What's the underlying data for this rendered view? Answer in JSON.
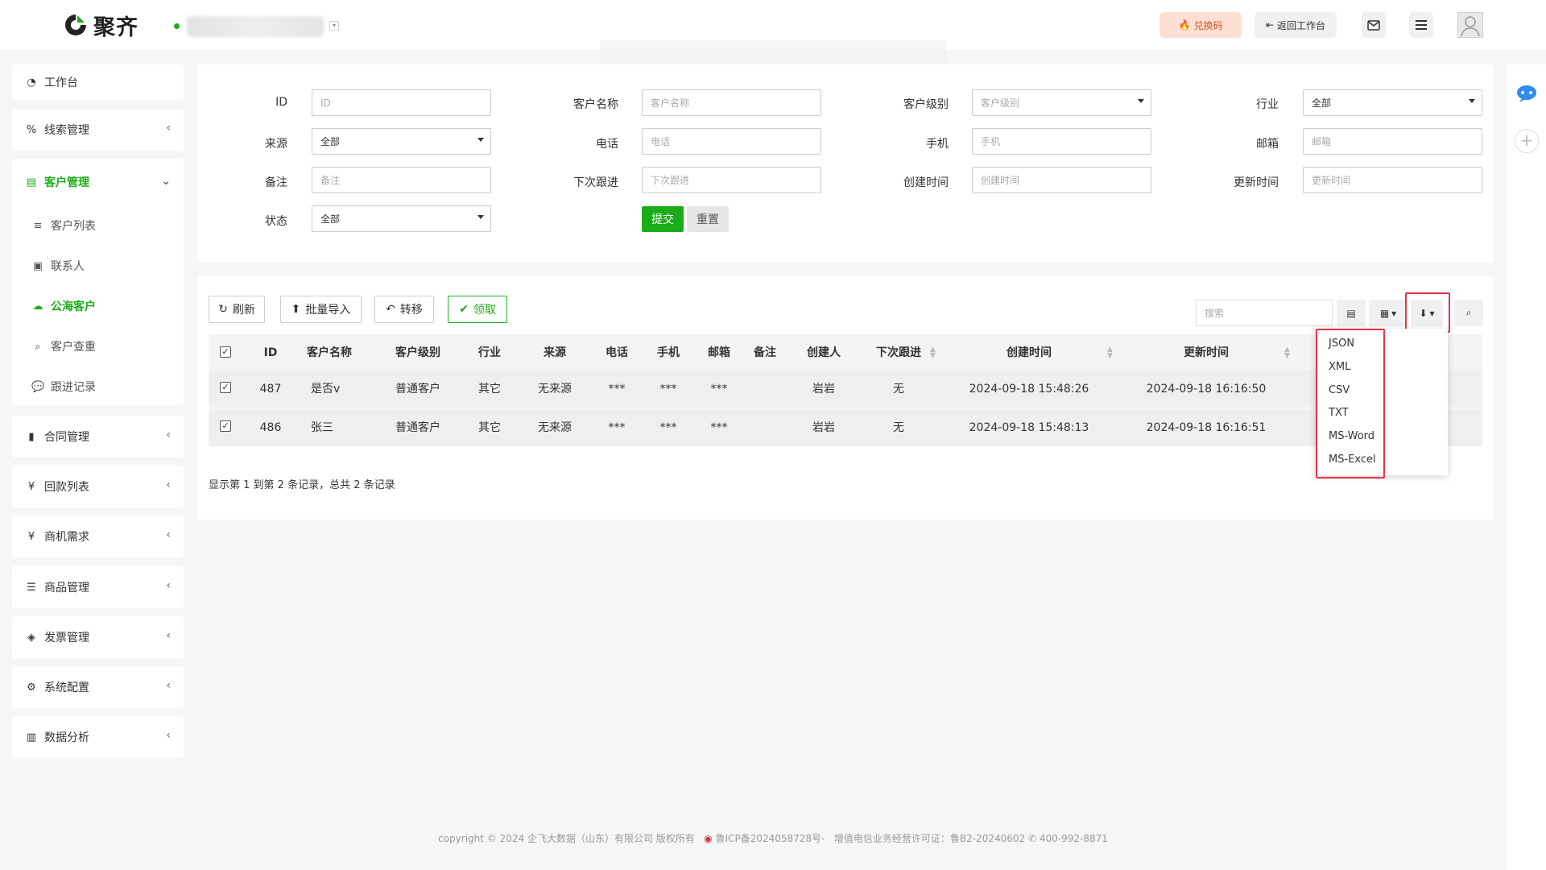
{
  "brand": {
    "name": "聚齐",
    "accent": "#1aad19",
    "warn": "#d0531e",
    "highlight": "#e8344a"
  },
  "header": {
    "redeem_label": "兑换码",
    "back_label": "返回工作台",
    "icons": [
      "fire-icon",
      "mail-icon",
      "menu-icon",
      "avatar-icon"
    ]
  },
  "sidebar": {
    "items": [
      {
        "label": "工作台",
        "icon": "dashboard-icon"
      },
      {
        "label": "线索管理",
        "icon": "link-icon"
      },
      {
        "label": "客户管理",
        "icon": "id-card-icon"
      },
      {
        "label": "合同管理",
        "icon": "bookmark-icon"
      },
      {
        "label": "回款列表",
        "icon": "yen-icon"
      },
      {
        "label": "商机需求",
        "icon": "yen-icon"
      },
      {
        "label": "商品管理",
        "icon": "list-icon"
      },
      {
        "label": "发票管理",
        "icon": "tag-icon"
      },
      {
        "label": "系统配置",
        "icon": "gears-icon"
      },
      {
        "label": "数据分析",
        "icon": "bar-chart-icon"
      }
    ],
    "sub_items": [
      {
        "label": "客户列表",
        "icon": "list-icon"
      },
      {
        "label": "联系人",
        "icon": "contact-icon"
      },
      {
        "label": "公海客户",
        "icon": "cloud-icon"
      },
      {
        "label": "客户查重",
        "icon": "search-icon"
      },
      {
        "label": "跟进记录",
        "icon": "chat-icon"
      }
    ]
  },
  "filter": {
    "labels": {
      "id": "ID",
      "name": "客户名称",
      "level": "客户级别",
      "industry": "行业",
      "source": "来源",
      "phone": "电话",
      "mobile": "手机",
      "email": "邮箱",
      "remark": "备注",
      "next": "下次跟进",
      "created": "创建时间",
      "updated": "更新时间",
      "status": "状态"
    },
    "placeholders": {
      "id": "ID",
      "name": "客户名称",
      "level": "客户级别",
      "phone": "电话",
      "mobile": "手机",
      "email": "邮箱",
      "remark": "备注",
      "next": "下次跟进",
      "created": "创建时间",
      "updated": "更新时间"
    },
    "selected": {
      "industry": "全部",
      "source": "全部",
      "status": "全部"
    },
    "submit_label": "提交",
    "reset_label": "重置"
  },
  "toolbar": {
    "refresh": "刷新",
    "import": "批量导入",
    "transfer": "转移",
    "claim": "领取",
    "search_placeholder": "搜索"
  },
  "table": {
    "headers": [
      "ID",
      "客户名称",
      "客户级别",
      "行业",
      "来源",
      "电话",
      "手机",
      "邮箱",
      "备注",
      "创建人",
      "下次跟进",
      "创建时间",
      "更新时间"
    ],
    "rows": [
      {
        "id": "487",
        "name": "是否v",
        "level": "普通客户",
        "industry": "其它",
        "source": "无来源",
        "phone": "***",
        "mobile": "***",
        "email": "***",
        "remark": "",
        "creator": "岩岩",
        "next": "无",
        "created": "2024-09-18 15:48:26",
        "updated": "2024-09-18 16:16:50"
      },
      {
        "id": "486",
        "name": "张三",
        "level": "普通客户",
        "industry": "其它",
        "source": "无来源",
        "phone": "***",
        "mobile": "***",
        "email": "***",
        "remark": "",
        "creator": "岩岩",
        "next": "无",
        "created": "2024-09-18 15:48:13",
        "updated": "2024-09-18 16:16:51"
      }
    ],
    "summary": "显示第 1 到第 2 条记录，总共 2 条记录"
  },
  "export_menu": [
    "JSON",
    "XML",
    "CSV",
    "TXT",
    "MS-Word",
    "MS-Excel"
  ],
  "footer": {
    "text": "copyright © 2024 企飞大数据（山东）有限公司 版权所有",
    "icp": "鲁ICP备2024058728号-",
    "license": "增值电信业务经营许可证：鲁B2-20240602",
    "phone": "400-992-8871"
  }
}
